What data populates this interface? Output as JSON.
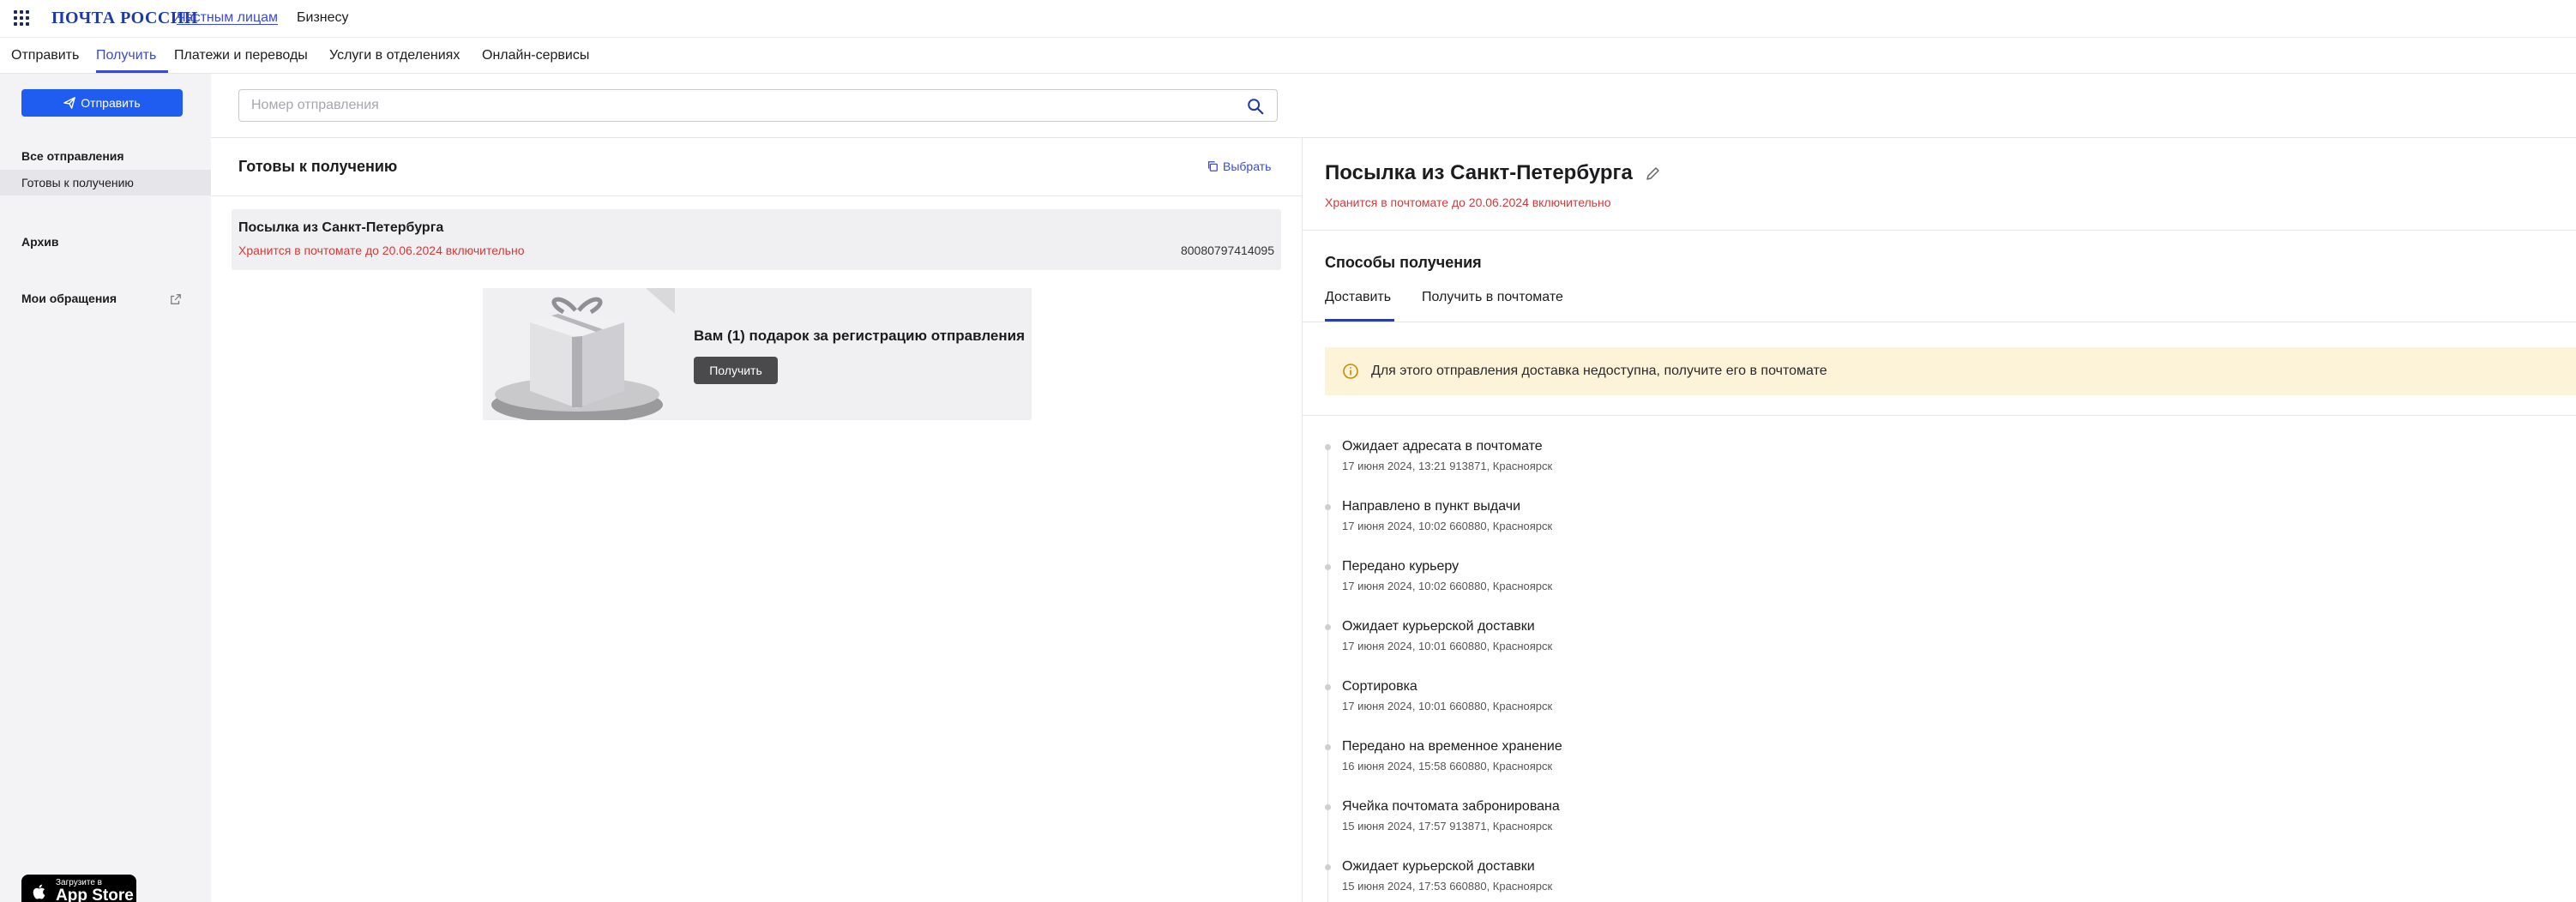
{
  "header": {
    "logo": "ПОЧТА РОССИИ",
    "links": [
      "Частным лицам",
      "Бизнесу"
    ]
  },
  "nav": {
    "items": [
      "Отправить",
      "Получить",
      "Платежи и переводы",
      "Услуги в отделениях",
      "Онлайн-сервисы"
    ],
    "active": "Получить"
  },
  "sidebar": {
    "send_button": "Отправить",
    "all_shipments": "Все отправления",
    "ready_item": "Готовы к получению",
    "archive": "Архив",
    "appeals": "Мои обращения",
    "appstore_small": "Загрузите в",
    "appstore_big": "App Store"
  },
  "search": {
    "placeholder": "Номер отправления",
    "value": ""
  },
  "list": {
    "title": "Готовы к получению",
    "select_label": "Выбрать",
    "card": {
      "title": "Посылка из Санкт-Петербурга",
      "status": "Хранится в почтомате до 20.06.2024 включительно",
      "number": "80080797414095"
    },
    "promo": {
      "title": "Вам (1) подарок за регистрацию отправления",
      "button": "Получить"
    }
  },
  "detail": {
    "title": "Посылка из Санкт-Петербурга",
    "status": "Хранится в почтомате до 20.06.2024 включительно",
    "methods_title": "Способы получения",
    "tabs": [
      "Доставить",
      "Получить в почтомате"
    ],
    "active_tab": "Доставить",
    "notice": "Для этого отправления доставка недоступна, получите его в почтомате",
    "events": [
      {
        "name": "Ожидает адресата в почтомате",
        "meta": "17 июня 2024, 13:21 913871, Красноярск"
      },
      {
        "name": "Направлено в пункт выдачи",
        "meta": "17 июня 2024, 10:02 660880, Красноярск"
      },
      {
        "name": "Передано курьеру",
        "meta": "17 июня 2024, 10:02 660880, Красноярск"
      },
      {
        "name": "Ожидает курьерской доставки",
        "meta": "17 июня 2024, 10:01 660880, Красноярск"
      },
      {
        "name": "Сортировка",
        "meta": "17 июня 2024, 10:01 660880, Красноярск"
      },
      {
        "name": "Передано на временное хранение",
        "meta": "16 июня 2024, 15:58 660880, Красноярск"
      },
      {
        "name": "Ячейка почтомата забронирована",
        "meta": "15 июня 2024, 17:57 913871, Красноярск"
      },
      {
        "name": "Ожидает курьерской доставки",
        "meta": "15 июня 2024, 17:53 660880, Красноярск"
      }
    ]
  },
  "colors": {
    "accent": "#3a4bd2",
    "primary_button": "#1f5cf0",
    "warning_text": "#d13a3a",
    "notice_bg": "#fdf3d8"
  }
}
